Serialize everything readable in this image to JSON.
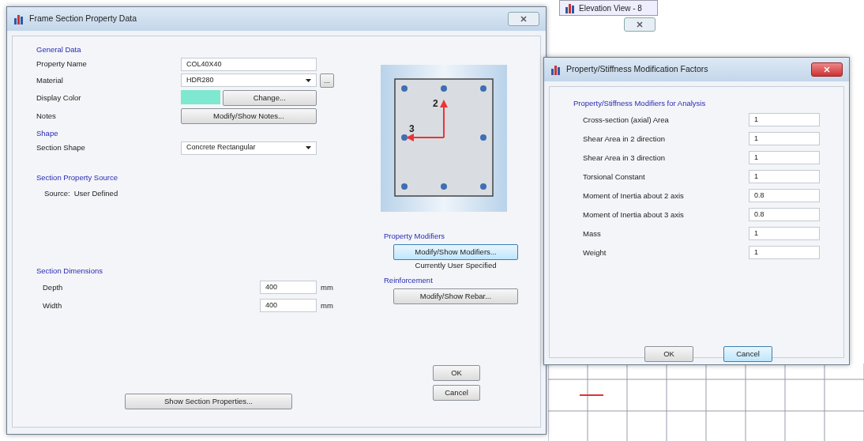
{
  "background": {
    "elevation_tab": {
      "title": "Elevation View - 8"
    }
  },
  "main_dialog": {
    "title": "Frame Section Property Data",
    "general_data": {
      "heading": "General Data",
      "property_name": {
        "label": "Property Name",
        "value": "COL40X40"
      },
      "material": {
        "label": "Material",
        "value": "HDR280",
        "more_button": "..."
      },
      "display_color": {
        "label": "Display Color",
        "color": "#7fe8d0",
        "button": "Change..."
      },
      "notes": {
        "label": "Notes",
        "button": "Modify/Show Notes..."
      }
    },
    "shape": {
      "heading": "Shape",
      "label": "Section Shape",
      "value": "Concrete Rectangular"
    },
    "source": {
      "heading": "Section Property Source",
      "label": "Source:",
      "value": "User Defined"
    },
    "dimensions": {
      "heading": "Section Dimensions",
      "rows": [
        {
          "label": "Depth",
          "value": "400",
          "unit": "mm"
        },
        {
          "label": "Width",
          "value": "400",
          "unit": "mm"
        }
      ]
    },
    "section_preview": {
      "axis_labels": [
        "2",
        "3"
      ]
    },
    "property_modifiers": {
      "heading": "Property Modifiers",
      "button": {
        "label": "Modify/Show Modifiers...",
        "focused": true
      },
      "status": "Currently User Specified"
    },
    "reinforcement": {
      "heading": "Reinforcement",
      "button": {
        "label": "Modify/Show Rebar...",
        "focused": false
      }
    },
    "show_section_properties": "Show Section Properties...",
    "buttons": [
      {
        "label": "OK",
        "focused": false
      },
      {
        "label": "Cancel",
        "focused": false
      }
    ]
  },
  "modifiers_dialog": {
    "title": "Property/Stiffness Modification Factors",
    "heading": "Property/Stiffness Modifiers for Analysis",
    "rows": [
      {
        "label": "Cross-section (axial) Area",
        "value": "1"
      },
      {
        "label": "Shear Area in 2 direction",
        "value": "1"
      },
      {
        "label": "Shear Area in 3 direction",
        "value": "1"
      },
      {
        "label": "Torsional Constant",
        "value": "1"
      },
      {
        "label": "Moment of Inertia about 2 axis",
        "value": "0.8"
      },
      {
        "label": "Moment of Inertia about 3 axis",
        "value": "0.8"
      },
      {
        "label": "Mass",
        "value": "1"
      },
      {
        "label": "Weight",
        "value": "1"
      }
    ],
    "buttons": [
      {
        "label": "OK",
        "focused": false
      },
      {
        "label": "Cancel",
        "focused": true
      }
    ]
  }
}
